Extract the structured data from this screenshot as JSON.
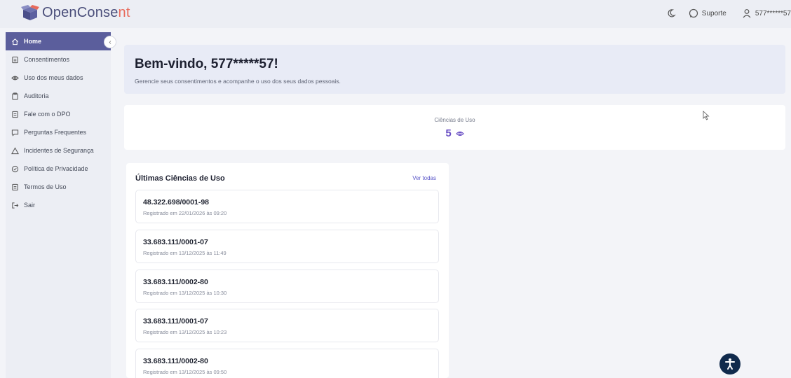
{
  "brand": {
    "name_main": "OpenConse",
    "name_accent": "nt"
  },
  "header": {
    "support_label": "Suporte",
    "user_label": "577******57"
  },
  "sidebar": {
    "items": [
      {
        "label": "Home",
        "icon": "home-icon",
        "active": true
      },
      {
        "label": "Consentimentos",
        "icon": "document-icon"
      },
      {
        "label": "Uso dos meus dados",
        "icon": "eye-icon"
      },
      {
        "label": "Auditoria",
        "icon": "clipboard-icon"
      },
      {
        "label": "Fale com o DPO",
        "icon": "document-icon"
      },
      {
        "label": "Perguntas Frequentes",
        "icon": "chat-icon"
      },
      {
        "label": "Incidentes de Segurança",
        "icon": "warning-icon"
      },
      {
        "label": "Política de Privacidade",
        "icon": "shield-icon"
      },
      {
        "label": "Termos de Uso",
        "icon": "document-icon"
      },
      {
        "label": "Sair",
        "icon": "logout-icon"
      }
    ]
  },
  "welcome": {
    "title": "Bem-vindo, 577*****57!",
    "subtitle": "Gerencie seus consentimentos e acompanhe o uso dos seus dados pessoais."
  },
  "stats": {
    "label": "Ciências de Uso",
    "value": "5"
  },
  "recent": {
    "title": "Últimas Ciências de Uso",
    "see_all": "Ver todas",
    "entries": [
      {
        "cnpj": "48.322.698/0001-98",
        "date": "Registrado em 22/01/2026 às 09:20"
      },
      {
        "cnpj": "33.683.111/0001-07",
        "date": "Registrado em 13/12/2025 às 11:49"
      },
      {
        "cnpj": "33.683.111/0002-80",
        "date": "Registrado em 13/12/2025 às 10:30"
      },
      {
        "cnpj": "33.683.111/0001-07",
        "date": "Registrado em 13/12/2025 às 10:23"
      },
      {
        "cnpj": "33.683.111/0002-80",
        "date": "Registrado em 13/12/2025 às 09:50"
      }
    ]
  },
  "colors": {
    "accent": "#5b5e9c",
    "value": "#6a4fc4",
    "link": "#5a56c8",
    "a11y": "#102a4c"
  }
}
